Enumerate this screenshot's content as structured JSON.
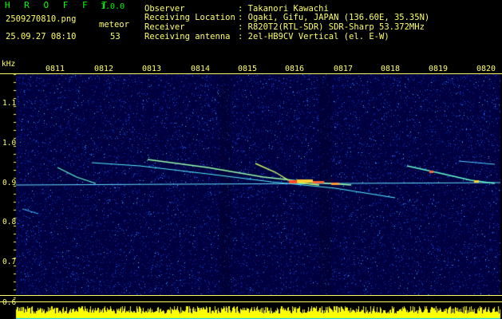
{
  "header": {
    "brand": "H R O F F T",
    "version": "1.0.0",
    "filename": "2509270810.png",
    "meteor_label": "meteor",
    "timestamp": "25.09.27 08:10",
    "meteor_count": "53",
    "info": [
      {
        "key": "Observer",
        "value": ": Takanori Kawachi"
      },
      {
        "key": "Receiving Location",
        "value": ": Ogaki, Gifu, JAPAN (136.60E, 35.35N)"
      },
      {
        "key": "Receiver",
        "value": ": R820T2(RTL-SDR) SDR-Sharp 53.372MHz"
      },
      {
        "key": "Receiving antenna",
        "value": ": 2el-HB9CV Vertical (el. E-W)"
      }
    ]
  },
  "axis": {
    "unit": "kHz",
    "y_labels": [
      "1.1",
      "1.0",
      "0.9",
      "0.8",
      "0.7",
      "0.6"
    ],
    "x_labels": [
      "0811",
      "0812",
      "0813",
      "0814",
      "0815",
      "0816",
      "0817",
      "0818",
      "0819",
      "0820"
    ]
  },
  "colors": {
    "text": "#ffff66",
    "brand": "#00ff00",
    "background": "#000000",
    "noise_base": "#000066",
    "level_bar": "#ffff00",
    "level_base": "#00ccff"
  }
}
